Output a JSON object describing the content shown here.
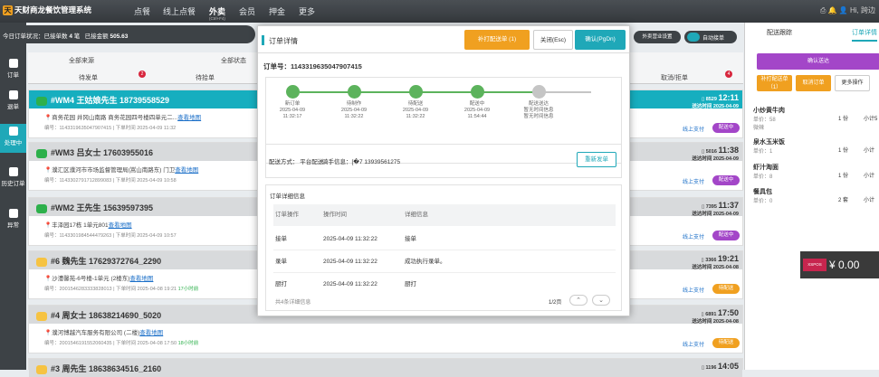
{
  "app": {
    "title": "天财商龙餐饮管理系统",
    "logo_char": "天"
  },
  "nav": {
    "items": [
      "点餐",
      "线上点餐",
      "外卖",
      "会员",
      "押金",
      "更多"
    ],
    "active_sub": "(Ctrl+F4)"
  },
  "topright": {
    "user": "Hi, 跨边"
  },
  "leftbar": {
    "items": [
      "订单",
      "退单",
      "处理中",
      "历史订单",
      "异常"
    ]
  },
  "status": {
    "label": "今日订单状况：已接单数",
    "count": "4",
    "unit": "笔",
    "amount_label": "已接金额",
    "amount": "505.63"
  },
  "header": {
    "all_source": "全部来源",
    "all_status": "全部状态",
    "tabs": [
      "待发单",
      "待拾单",
      "取消/拒单"
    ],
    "badges": [
      "2",
      "4"
    ]
  },
  "orders": [
    {
      "icon": "wechat",
      "title": "#WM4  王姑娘先生  18739558529",
      "addr": "商务花园 井冈山南路 商务花园四号楼四单元二...",
      "addr_link": "查看地图",
      "meta": "编号：1143319635047907415 | 下单时间 2025-04-09 11:32",
      "pr": "8529",
      "time": "12:11",
      "sub": "送达时间 2025-04-09",
      "pay": "线上支付",
      "status": "配送中"
    },
    {
      "icon": "wechat",
      "title": "#WM3  吕女士  17603955016",
      "addr": "濮汇区濮河市市场监督管理局(嵩山南路东) 门卫",
      "addr_link": "查看地图",
      "meta": "编号：1143302791712899083 | 下单时间 2025-04-09 10:58",
      "pr": "5016",
      "time": "11:38",
      "sub": "送达时间 2025-04-09",
      "pay": "线上支付",
      "status": "配送中"
    },
    {
      "icon": "wechat",
      "title": "#WM2  王先生  15639597395",
      "addr": "丰泽园17栋 1单元801",
      "addr_link": "查看地图",
      "meta": "编号：1143301984544479263 | 下单时间 2025-04-09 10:57",
      "pr": "7395",
      "time": "11:37",
      "sub": "送达时间 2025-04-09",
      "pay": "线上支付",
      "status": "配送中"
    },
    {
      "icon": "meituan",
      "title": "#6  魏先生  17629372764_2290",
      "addr": "沙澧馨苑-6号楼-1单元 (2楼东)",
      "addr_link": "查看地图",
      "meta": "编号：2001546283333828013 | 下单时间 2025-04-08 19:21",
      "extra": "17小时前",
      "pr": "3366",
      "time": "19:21",
      "sub": "送达时间 2025-04-08",
      "pay": "线上支付",
      "status": "待配送"
    },
    {
      "icon": "meituan",
      "title": "#4  周女士  18638214690_5020",
      "addr": "濮河博越汽车服务有限公司 (二楼)",
      "addr_link": "查看地图",
      "meta": "编号：2001546191552060435 | 下单时间 2025-04-08 17:50",
      "extra": "18小时前",
      "pr": "6891",
      "time": "17:50",
      "sub": "送达时间 2025-04-08",
      "pay": "线上支付",
      "status": "待配送"
    },
    {
      "icon": "meituan",
      "title": "#3  周先生  18638634516_2160",
      "pr": "1196",
      "time": "14:05"
    }
  ],
  "modal": {
    "title": "订单详情",
    "btn_print": "补打配送单 (1)",
    "btn_close": "关闭(Esc)",
    "btn_confirm": "确认(PgDn)",
    "order_no": "订单号：1143319635047907415",
    "steps": [
      {
        "name": "新订单",
        "date": "2025-04-09",
        "time": "11:32:17"
      },
      {
        "name": "待制作",
        "date": "2025-04-09",
        "time": "11:32:22"
      },
      {
        "name": "待配送",
        "date": "2025-04-09",
        "time": "11:32:22"
      },
      {
        "name": "配送中",
        "date": "2025-04-09",
        "time": "11:54:44"
      },
      {
        "name": "配送送达",
        "date": "暂无时间信息",
        "time": "暂无时间信息"
      }
    ],
    "delivery": "配送方式：  平台配送",
    "rider": "骑手信息：[�7 13939561275",
    "resend": "重新发单",
    "detail_title": "订单详细信息",
    "cols": [
      "订单操作",
      "操作时间",
      "详细信息"
    ],
    "rows": [
      [
        "接单",
        "2025-04-09 11:32:22",
        "接单"
      ],
      [
        "录单",
        "2025-04-09 11:32:22",
        "成功执行录单。"
      ],
      [
        "厨打",
        "2025-04-09 11:32:22",
        "厨打"
      ]
    ],
    "footer": "共4条详细信息",
    "page": "1/2页"
  },
  "topcontrols": {
    "dropdown": "外卖营业设置",
    "switch": "自动接单"
  },
  "rpanel": {
    "tabs": [
      "配送跟踪",
      "订单详情"
    ],
    "btn_confirm": "确认送达",
    "btn_print": "补打配送单（1）",
    "btn_cancel": "取消订单",
    "btn_more": "更多操作",
    "items": [
      {
        "name": "小炒黄牛肉",
        "price": "单价：58",
        "note": "微辣",
        "qty": "1 份",
        "sub": "小计5"
      },
      {
        "name": "泉水玉米饭",
        "price": "单价：1",
        "qty": "1 份",
        "sub": "小计"
      },
      {
        "name": "虾汁淘面",
        "price": "单价：8",
        "qty": "1 份",
        "sub": "小计"
      },
      {
        "name": "餐具包",
        "price": "单价：0",
        "qty": "2 套",
        "sub": "小计"
      }
    ]
  },
  "pay": {
    "logo": "XSPOS",
    "amount": "¥ 0.00"
  },
  "colors": {
    "accent": "#1fa8b8",
    "orange": "#f0a020",
    "purple": "#a346c8",
    "dark": "#3d4246"
  }
}
